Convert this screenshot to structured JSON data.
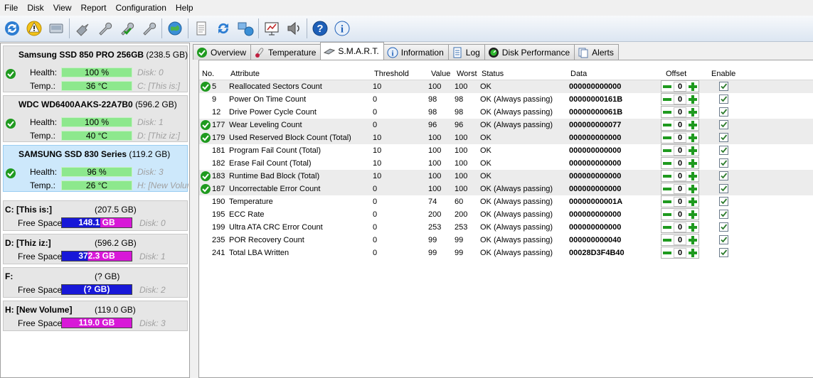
{
  "menu": [
    "File",
    "Disk",
    "View",
    "Report",
    "Configuration",
    "Help"
  ],
  "toolbar_icons": [
    "rescan-icon",
    "health-alert-icon",
    "disk-icon",
    "wrench-group-icon",
    "wrench-icon",
    "wrench-check-icon",
    "wrench-x-icon",
    "globe-icon",
    "notepad-icon",
    "refresh-icon",
    "network-icon",
    "presentation-icon",
    "speaker-icon",
    "help-icon",
    "info-icon"
  ],
  "disks": [
    {
      "name": "Samsung SSD 850 PRO 256GB",
      "size": "(238.5 GB)",
      "health_label": "Health:",
      "health": "100 %",
      "disk": "Disk: 0",
      "temp_label": "Temp.:",
      "temp": "36 °C",
      "vol": "C: [This is:]"
    },
    {
      "name": "WDC WD6400AAKS-22A7B0",
      "size": "(596.2 GB)",
      "health_label": "Health:",
      "health": "100 %",
      "disk": "Disk: 1",
      "temp_label": "Temp.:",
      "temp": "40 °C",
      "vol": "D: [Thiz iz:]"
    },
    {
      "name": "SAMSUNG SSD 830 Series",
      "size": "(119.2 GB)",
      "health_label": "Health:",
      "health": "96 %",
      "disk": "Disk: 3",
      "temp_label": "Temp.:",
      "temp": "26 °C",
      "vol": "H: [New Volume]"
    }
  ],
  "drives": [
    {
      "name": "C: [This is:]",
      "size": "(207.5 GB)",
      "free_label": "Free Space",
      "free": "148.1 GB",
      "disk": "Disk: 0",
      "bar_color": "#1818d8"
    },
    {
      "name": "D: [Thiz iz:]",
      "size": "(596.2 GB)",
      "free_label": "Free Space",
      "free": "372.3 GB",
      "disk": "Disk: 1",
      "bar_color": "#1818d8"
    },
    {
      "name": "F:",
      "size": "(? GB)",
      "free_label": "Free Space",
      "free": "(? GB)",
      "disk": "Disk: 2",
      "bar_color": "#1818d8"
    },
    {
      "name": "H: [New Volume]",
      "size": "(119.0 GB)",
      "free_label": "Free Space",
      "free": "119.0 GB",
      "disk": "Disk: 3",
      "bar_color": "#d818d8"
    }
  ],
  "tabs": [
    "Overview",
    "Temperature",
    "S.M.A.R.T.",
    "Information",
    "Log",
    "Disk Performance",
    "Alerts"
  ],
  "active_tab": "S.M.A.R.T.",
  "columns": [
    "No.",
    "Attribute",
    "Threshold",
    "Value",
    "Worst",
    "Status",
    "Data",
    "Offset",
    "Enable"
  ],
  "rows": [
    {
      "ok": true,
      "no": "5",
      "attr": "Reallocated Sectors Count",
      "thr": "10",
      "val": "100",
      "worst": "100",
      "status": "OK",
      "data": "000000000000",
      "offset": "0",
      "shade": true
    },
    {
      "ok": false,
      "no": "9",
      "attr": "Power On Time Count",
      "thr": "0",
      "val": "98",
      "worst": "98",
      "status": "OK (Always passing)",
      "data": "00000000161B",
      "offset": "0",
      "shade": false
    },
    {
      "ok": false,
      "no": "12",
      "attr": "Drive Power Cycle Count",
      "thr": "0",
      "val": "98",
      "worst": "98",
      "status": "OK (Always passing)",
      "data": "00000000061B",
      "offset": "0",
      "shade": false
    },
    {
      "ok": true,
      "no": "177",
      "attr": "Wear Leveling Count",
      "thr": "0",
      "val": "96",
      "worst": "96",
      "status": "OK (Always passing)",
      "data": "000000000077",
      "offset": "0",
      "shade": true
    },
    {
      "ok": true,
      "no": "179",
      "attr": "Used Reserved Block Count (Total)",
      "thr": "10",
      "val": "100",
      "worst": "100",
      "status": "OK",
      "data": "000000000000",
      "offset": "0",
      "shade": true
    },
    {
      "ok": false,
      "no": "181",
      "attr": "Program Fail Count (Total)",
      "thr": "10",
      "val": "100",
      "worst": "100",
      "status": "OK",
      "data": "000000000000",
      "offset": "0",
      "shade": false
    },
    {
      "ok": false,
      "no": "182",
      "attr": "Erase Fail Count (Total)",
      "thr": "10",
      "val": "100",
      "worst": "100",
      "status": "OK",
      "data": "000000000000",
      "offset": "0",
      "shade": false
    },
    {
      "ok": true,
      "no": "183",
      "attr": "Runtime Bad Block (Total)",
      "thr": "10",
      "val": "100",
      "worst": "100",
      "status": "OK",
      "data": "000000000000",
      "offset": "0",
      "shade": true
    },
    {
      "ok": true,
      "no": "187",
      "attr": "Uncorrectable Error Count",
      "thr": "0",
      "val": "100",
      "worst": "100",
      "status": "OK (Always passing)",
      "data": "000000000000",
      "offset": "0",
      "shade": true
    },
    {
      "ok": false,
      "no": "190",
      "attr": "Temperature",
      "thr": "0",
      "val": "74",
      "worst": "60",
      "status": "OK (Always passing)",
      "data": "00000000001A",
      "offset": "0",
      "shade": false
    },
    {
      "ok": false,
      "no": "195",
      "attr": "ECC Rate",
      "thr": "0",
      "val": "200",
      "worst": "200",
      "status": "OK (Always passing)",
      "data": "000000000000",
      "offset": "0",
      "shade": false
    },
    {
      "ok": false,
      "no": "199",
      "attr": "Ultra ATA CRC Error Count",
      "thr": "0",
      "val": "253",
      "worst": "253",
      "status": "OK (Always passing)",
      "data": "000000000000",
      "offset": "0",
      "shade": false
    },
    {
      "ok": false,
      "no": "235",
      "attr": "POR Recovery Count",
      "thr": "0",
      "val": "99",
      "worst": "99",
      "status": "OK (Always passing)",
      "data": "000000000040",
      "offset": "0",
      "shade": false
    },
    {
      "ok": false,
      "no": "241",
      "attr": "Total LBA Written",
      "thr": "0",
      "val": "99",
      "worst": "99",
      "status": "OK (Always passing)",
      "data": "00028D3F4B40",
      "offset": "0",
      "shade": false
    }
  ],
  "colors": {
    "health_bar": "#8de88d",
    "ok_icon": "#1f9a1f",
    "accent": "#2a6fc9"
  }
}
